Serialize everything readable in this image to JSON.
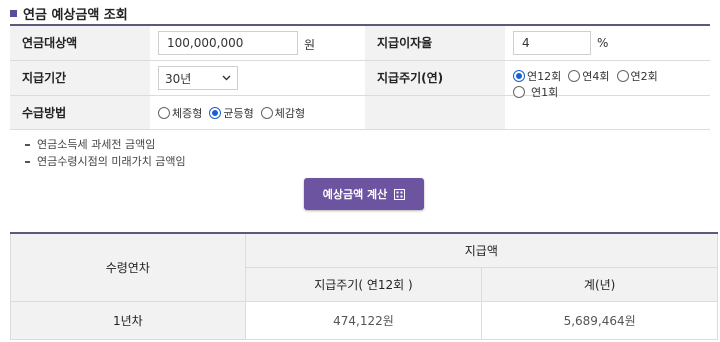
{
  "title": "연금 예상금액 조회",
  "form": {
    "principal_label": "연금대상액",
    "principal_value": "100,000,000",
    "principal_unit": "원",
    "rate_label": "지급이자율",
    "rate_value": "4",
    "rate_unit": "%",
    "period_label": "지급기간",
    "period_value": "30년",
    "cycle_label": "지급주기(연)",
    "cycle_options": [
      "연12회",
      "연4회",
      "연2회",
      "연1회"
    ],
    "cycle_selected": "연12회",
    "method_label": "수급방법",
    "method_options": [
      "체증형",
      "균등형",
      "체감형"
    ],
    "method_selected": "균등형"
  },
  "notes": [
    "연금소득세 과세전 금액임",
    "연금수령시점의 미래가치 금액임"
  ],
  "calc_button": "예상금액 계산",
  "result": {
    "col_year": "수령연차",
    "col_group": "지급액",
    "col_cycle": "지급주기( 연12회 )",
    "col_total": "계(년)",
    "rows": [
      {
        "year": "1년차",
        "cycle_amount": "474,122원",
        "total": "5,689,464원"
      }
    ]
  }
}
